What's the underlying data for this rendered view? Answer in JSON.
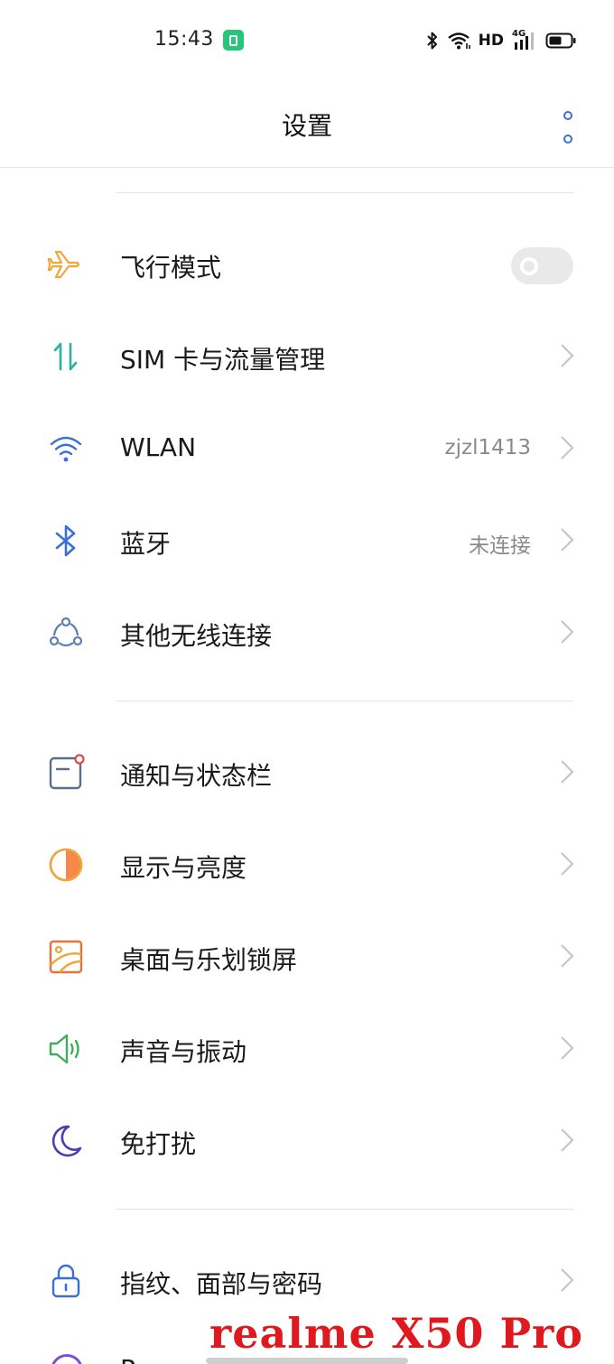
{
  "status_bar": {
    "time": "15:43",
    "hd": "HD",
    "network": "4G"
  },
  "header": {
    "title": "设置"
  },
  "settings": [
    {
      "id": "airplane",
      "icon": "airplane-icon",
      "label": "飞行模式",
      "value": "",
      "control": "toggle",
      "toggle_on": false,
      "accent": "#f0a63a"
    },
    {
      "id": "sim",
      "icon": "sim-data-icon",
      "label": "SIM 卡与流量管理",
      "value": "",
      "control": "chevron",
      "accent": "#2bb39b"
    },
    {
      "id": "wlan",
      "icon": "wifi-icon",
      "label": "WLAN",
      "value": "zjzl1413",
      "control": "chevron",
      "accent": "#3b6fd8"
    },
    {
      "id": "bluetooth",
      "icon": "bluetooth-icon",
      "label": "蓝牙",
      "value": "未连接",
      "control": "chevron",
      "accent": "#3b6fd8"
    },
    {
      "id": "other-wireless",
      "icon": "connections-icon",
      "label": "其他无线连接",
      "value": "",
      "control": "chevron",
      "accent": "#5a7fb0"
    },
    {
      "id": "notifications",
      "icon": "notification-icon",
      "label": "通知与状态栏",
      "value": "",
      "control": "chevron",
      "accent": "#5a6f8a"
    },
    {
      "id": "display",
      "icon": "brightness-icon",
      "label": "显示与亮度",
      "value": "",
      "control": "chevron",
      "accent": "#f0a63a"
    },
    {
      "id": "home-screen",
      "icon": "wallpaper-icon",
      "label": "桌面与乐划锁屏",
      "value": "",
      "control": "chevron",
      "accent": "#e8733a"
    },
    {
      "id": "sound",
      "icon": "speaker-icon",
      "label": "声音与振动",
      "value": "",
      "control": "chevron",
      "accent": "#3fae5a"
    },
    {
      "id": "dnd",
      "icon": "moon-icon",
      "label": "免打扰",
      "value": "",
      "control": "chevron",
      "accent": "#4a3fb0"
    },
    {
      "id": "security",
      "icon": "lock-icon",
      "label": "指纹、面部与密码",
      "value": "",
      "control": "chevron",
      "accent": "#3b6fd8"
    }
  ],
  "partial_row": {
    "label": "P"
  },
  "watermark": "realme X50 Pro"
}
